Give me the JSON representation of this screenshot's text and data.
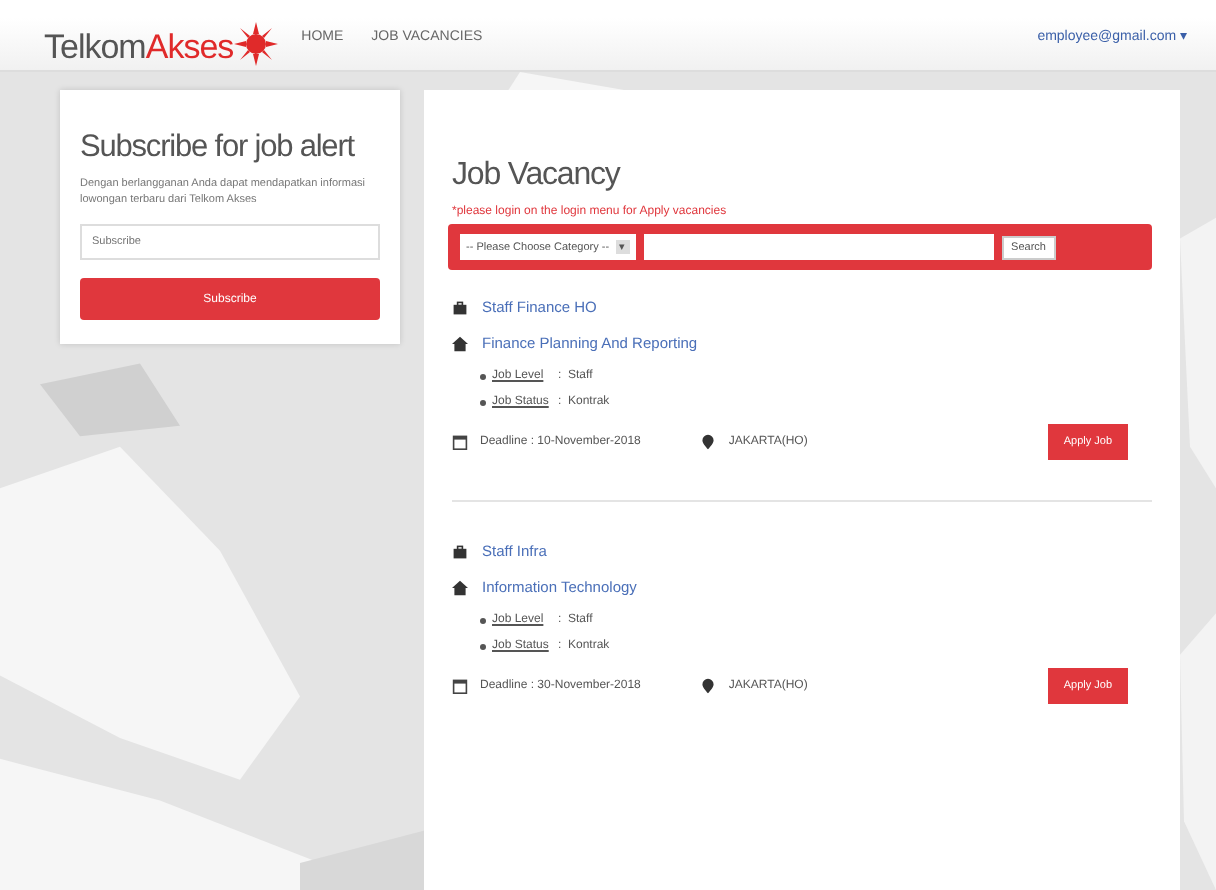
{
  "header": {
    "logo": {
      "part_1": "Telkom",
      "part_2": "Akses"
    },
    "nav": [
      {
        "label": "HOME"
      },
      {
        "label": "JOB VACANCIES"
      }
    ],
    "user_menu": "employee@gmail.com ▾"
  },
  "subscribe": {
    "title": "Subscribe for job alert",
    "description": "Dengan berlangganan Anda dapat mendapatkan informasi lowongan terbaru dari Telkom Akses",
    "email": {
      "placeholder": "Subscribe"
    },
    "button": "Subscribe"
  },
  "vacancy": {
    "title": "Job Vacancy",
    "note": "*please login on the login menu for Apply vacancies",
    "category": "-- Please Choose Category --",
    "category_caret": "▾",
    "search_button": "Search",
    "jobs": [
      {
        "title": "Staff Finance HO",
        "department": "Finance Planning And Reporting",
        "details": [
          {
            "label": "Job Level",
            "value": ":  Staff"
          },
          {
            "label": "Job Status",
            "value": ":  Kontrak"
          }
        ],
        "deadline": "Deadline : 10-November-2018",
        "location": "JAKARTA(HO)",
        "button": "Apply Job"
      },
      {
        "title": "Staff Infra",
        "department": "Information Technology",
        "details": [
          {
            "label": "Job Level",
            "value": ":  Staff"
          },
          {
            "label": "Job Status",
            "value": ":  Kontrak"
          }
        ],
        "deadline": "Deadline : 30-November-2018",
        "location": "JAKARTA(HO)",
        "button": "Apply Job"
      }
    ]
  }
}
